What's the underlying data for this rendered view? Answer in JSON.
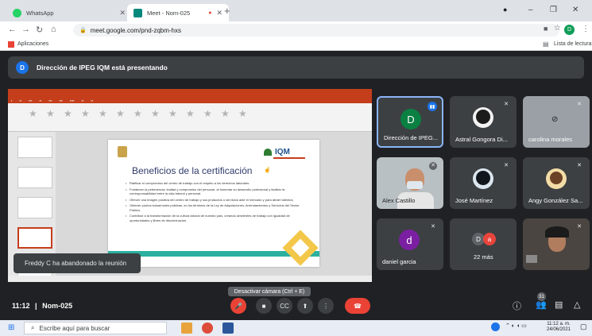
{
  "browser": {
    "tabs": [
      {
        "title": "WhatsApp",
        "icon": "whatsapp-icon"
      },
      {
        "title": "Meet - Nom-025",
        "icon": "meet-icon"
      }
    ],
    "url": "meet.google.com/pnd-zqbm-hxs",
    "profile_initial": "D",
    "bookmarks_label": "Aplicaciones",
    "reading_list_label": "Lista de lectura"
  },
  "meet": {
    "banner_initial": "D",
    "banner_text": "Dirección de IPEG IQM está presentando",
    "toast": "Freddy C ha abandonado la reunión",
    "time": "11:12",
    "separator": "|",
    "meeting_code": "Nom-025",
    "tooltip": "Desactivar cámara (Ctrl + E)",
    "participant_count": "31",
    "participants": [
      {
        "name": "Dirección de IPEG...",
        "initial": "D",
        "avatar_color": "#0b8043"
      },
      {
        "name": "Astral Gongora Di..."
      },
      {
        "name": "carolina morales"
      },
      {
        "name": "Alex Castillo"
      },
      {
        "name": "José Martínez"
      },
      {
        "name": "Angy González Sa..."
      },
      {
        "name": "daniel garcia",
        "initial": "d",
        "avatar_color": "#7b1fa2"
      },
      {
        "name": "22 más",
        "initial_a": "D",
        "initial_b": "a"
      },
      {
        "name": ""
      }
    ]
  },
  "slide": {
    "title": "Beneficios de la certificación",
    "logo_text": "IQM",
    "bullets": [
      "Ratificar el compromiso del centro de trabajo con el respeto a los derechos laborales.",
      "Fortalecer la pertenencia, lealtad y compromiso del personal, al fomentar su desarrollo profesional y facilitar la corresponsabilidad entre la vida laboral y personal.",
      "Ofrecer una imagen positiva del centro de trabajo y sus productos o servicios ante el mercado y para atraer talentos.",
      "Obtener puntos bolsa/nones públicas, en los términos de la Ley de Adquisiciones, Arrendamientos y Servicios del Sector Público.",
      "Contribuir a la transformación de la cultura laboral de nuestro país, creando ambientes de trabajo con igualdad de oportunidades y libres de discriminación."
    ]
  },
  "taskbar": {
    "search_placeholder": "Escribe aquí para buscar",
    "clock_time": "11:12 a. m.",
    "clock_date": "24/06/2021"
  },
  "colors": {
    "meet_bg": "#202124",
    "tile_bg": "#3c4043",
    "leave_red": "#ea4335",
    "powerpoint_red": "#c43e1c",
    "active_blue": "#8ab4f8"
  }
}
